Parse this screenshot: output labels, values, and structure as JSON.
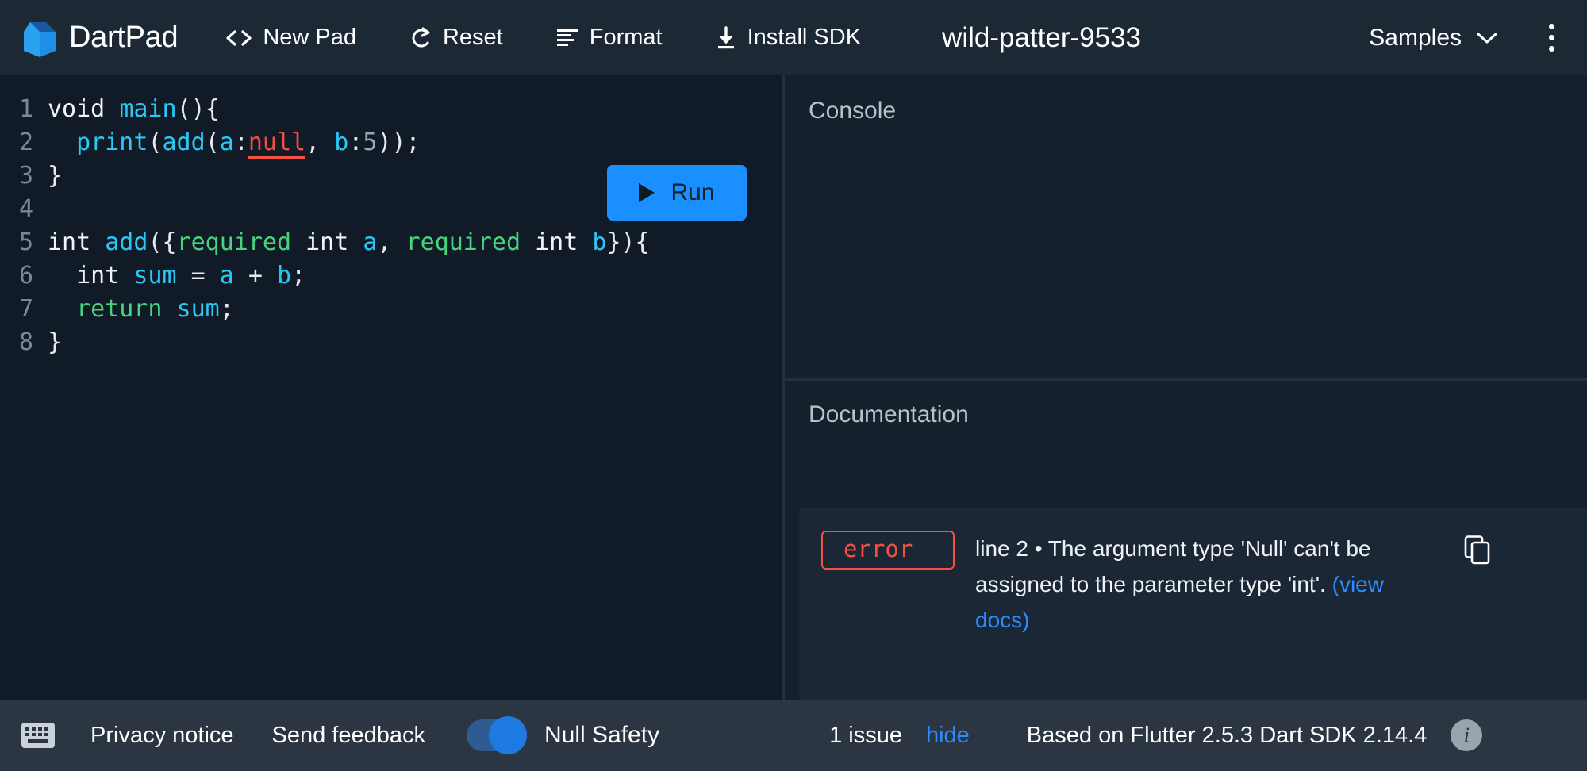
{
  "header": {
    "brand": "DartPad",
    "logo_icon": "dart-logo-icon",
    "buttons": [
      {
        "label": "New Pad",
        "icon": "code-brackets-icon"
      },
      {
        "label": "Reset",
        "icon": "refresh-icon"
      },
      {
        "label": "Format",
        "icon": "format-align-icon"
      },
      {
        "label": "Install SDK",
        "icon": "download-icon"
      }
    ],
    "pad_title": "wild-patter-9533",
    "samples_label": "Samples",
    "samples_icon": "chevron-down-icon",
    "overflow_icon": "more-vertical-icon",
    "background": "#1c2834"
  },
  "editor": {
    "run_label": "Run",
    "run_icon": "play-icon",
    "run_color": "#1a8fff",
    "lines": [
      {
        "num": "1",
        "tokens": [
          {
            "t": "void ",
            "c": "k-white"
          },
          {
            "t": "main",
            "c": "k-cyan"
          },
          {
            "t": "(){",
            "c": "k-punct"
          }
        ]
      },
      {
        "num": "2",
        "tokens": [
          {
            "t": "  ",
            "c": "k-punct"
          },
          {
            "t": "print",
            "c": "k-cyan"
          },
          {
            "t": "(",
            "c": "k-punct"
          },
          {
            "t": "add",
            "c": "k-cyan"
          },
          {
            "t": "(",
            "c": "k-punct"
          },
          {
            "t": "a",
            "c": "k-cyan"
          },
          {
            "t": ":",
            "c": "k-punct"
          },
          {
            "t": "null",
            "c": "k-red"
          },
          {
            "t": ", ",
            "c": "k-punct"
          },
          {
            "t": "b",
            "c": "k-cyan"
          },
          {
            "t": ":",
            "c": "k-punct"
          },
          {
            "t": "5",
            "c": "k-num"
          },
          {
            "t": "));",
            "c": "k-punct"
          }
        ]
      },
      {
        "num": "3",
        "tokens": [
          {
            "t": "}",
            "c": "k-punct"
          }
        ]
      },
      {
        "num": "4",
        "tokens": [
          {
            "t": "",
            "c": "k-punct"
          }
        ]
      },
      {
        "num": "5",
        "tokens": [
          {
            "t": "int ",
            "c": "k-white"
          },
          {
            "t": "add",
            "c": "k-cyan"
          },
          {
            "t": "({",
            "c": "k-punct"
          },
          {
            "t": "required",
            "c": "k-green"
          },
          {
            "t": " int ",
            "c": "k-white"
          },
          {
            "t": "a",
            "c": "k-cyan"
          },
          {
            "t": ", ",
            "c": "k-punct"
          },
          {
            "t": "required",
            "c": "k-green"
          },
          {
            "t": " int ",
            "c": "k-white"
          },
          {
            "t": "b",
            "c": "k-cyan"
          },
          {
            "t": "}){",
            "c": "k-punct"
          }
        ]
      },
      {
        "num": "6",
        "tokens": [
          {
            "t": "  int ",
            "c": "k-white"
          },
          {
            "t": "sum",
            "c": "k-cyan"
          },
          {
            "t": " = ",
            "c": "k-punct"
          },
          {
            "t": "a",
            "c": "k-cyan"
          },
          {
            "t": " + ",
            "c": "k-punct"
          },
          {
            "t": "b",
            "c": "k-cyan"
          },
          {
            "t": ";",
            "c": "k-punct"
          }
        ]
      },
      {
        "num": "7",
        "tokens": [
          {
            "t": "  ",
            "c": "k-punct"
          },
          {
            "t": "return",
            "c": "k-green"
          },
          {
            "t": " ",
            "c": "k-punct"
          },
          {
            "t": "sum",
            "c": "k-cyan"
          },
          {
            "t": ";",
            "c": "k-punct"
          }
        ]
      },
      {
        "num": "8",
        "tokens": [
          {
            "t": "}",
            "c": "k-punct"
          }
        ]
      }
    ]
  },
  "console": {
    "title": "Console",
    "output": ""
  },
  "documentation": {
    "title": "Documentation",
    "issue": {
      "severity": "error",
      "severity_color": "#f4503f",
      "text_before": "line 2 • The argument type 'Null' can't be assigned to the parameter type 'int'. ",
      "link_text": "(view docs)",
      "copy_icon": "copy-icon"
    }
  },
  "status_bar": {
    "keyboard_icon": "keyboard-icon",
    "privacy_label": "Privacy notice",
    "feedback_label": "Send feedback",
    "null_safety_label": "Null Safety",
    "null_safety_on": true,
    "issue_count": "1 issue",
    "hide_label": "hide",
    "sdk_info": "Based on Flutter 2.5.3 Dart SDK 2.14.4",
    "info_icon": "info-icon",
    "background": "#2c3642"
  }
}
